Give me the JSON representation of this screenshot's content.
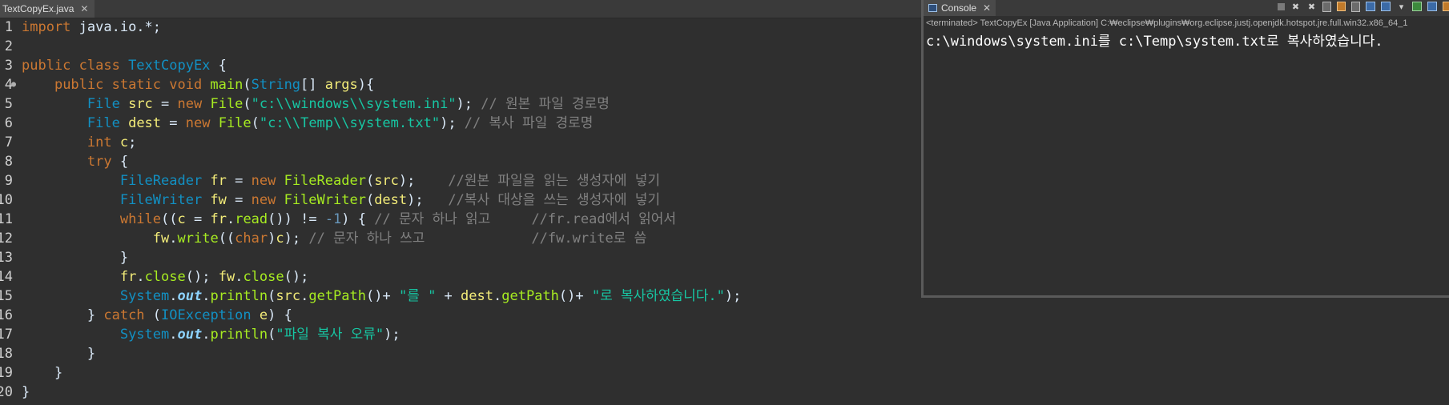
{
  "editor": {
    "tab_title": "TextCopyEx.java",
    "tab_close": "✕"
  },
  "code_lines": [
    {
      "num": "1",
      "marker": "",
      "tokens": [
        [
          "kw",
          "import"
        ],
        [
          "plain",
          " java.io.*;"
        ]
      ]
    },
    {
      "num": "2",
      "marker": "",
      "tokens": []
    },
    {
      "num": "3",
      "marker": "",
      "tokens": [
        [
          "kw",
          "public class "
        ],
        [
          "cls",
          "TextCopyEx"
        ],
        [
          "plain",
          " {"
        ]
      ]
    },
    {
      "num": "4",
      "marker": "●",
      "tokens": [
        [
          "plain",
          "    "
        ],
        [
          "kw",
          "public static void "
        ],
        [
          "fn",
          "main"
        ],
        [
          "plain",
          "("
        ],
        [
          "cls",
          "String"
        ],
        [
          "plain",
          "[] "
        ],
        [
          "var",
          "args"
        ],
        [
          "plain",
          "){"
        ]
      ]
    },
    {
      "num": "5",
      "marker": "",
      "tokens": [
        [
          "plain",
          "        "
        ],
        [
          "cls",
          "File "
        ],
        [
          "var",
          "src"
        ],
        [
          "plain",
          " = "
        ],
        [
          "kw",
          "new "
        ],
        [
          "fn",
          "File"
        ],
        [
          "plain",
          "("
        ],
        [
          "str",
          "\"c:\\\\windows\\\\system.ini\""
        ],
        [
          "plain",
          "); "
        ],
        [
          "cmt",
          "// 원본 파일 경로명"
        ]
      ]
    },
    {
      "num": "6",
      "marker": "",
      "tokens": [
        [
          "plain",
          "        "
        ],
        [
          "cls",
          "File "
        ],
        [
          "var",
          "dest"
        ],
        [
          "plain",
          " = "
        ],
        [
          "kw",
          "new "
        ],
        [
          "fn",
          "File"
        ],
        [
          "plain",
          "("
        ],
        [
          "str",
          "\"c:\\\\Temp\\\\system.txt\""
        ],
        [
          "plain",
          "); "
        ],
        [
          "cmt",
          "// 복사 파일 경로명"
        ]
      ]
    },
    {
      "num": "7",
      "marker": "",
      "tokens": [
        [
          "plain",
          "        "
        ],
        [
          "kw",
          "int "
        ],
        [
          "var",
          "c"
        ],
        [
          "plain",
          ";"
        ]
      ]
    },
    {
      "num": "8",
      "marker": "",
      "tokens": [
        [
          "plain",
          "        "
        ],
        [
          "kw",
          "try"
        ],
        [
          "plain",
          " {"
        ]
      ]
    },
    {
      "num": "9",
      "marker": "",
      "tokens": [
        [
          "plain",
          "            "
        ],
        [
          "cls",
          "FileReader "
        ],
        [
          "var",
          "fr"
        ],
        [
          "plain",
          " = "
        ],
        [
          "kw",
          "new "
        ],
        [
          "fn",
          "FileReader"
        ],
        [
          "plain",
          "("
        ],
        [
          "var",
          "src"
        ],
        [
          "plain",
          ");    "
        ],
        [
          "cmt",
          "//원본 파일을 읽는 생성자에 넣기"
        ]
      ]
    },
    {
      "num": "10",
      "marker": "",
      "tokens": [
        [
          "plain",
          "            "
        ],
        [
          "cls",
          "FileWriter "
        ],
        [
          "var",
          "fw"
        ],
        [
          "plain",
          " = "
        ],
        [
          "kw",
          "new "
        ],
        [
          "fn",
          "FileWriter"
        ],
        [
          "plain",
          "("
        ],
        [
          "var",
          "dest"
        ],
        [
          "plain",
          ");   "
        ],
        [
          "cmt",
          "//복사 대상을 쓰는 생성자에 넣기"
        ]
      ]
    },
    {
      "num": "11",
      "marker": "",
      "tokens": [
        [
          "plain",
          "            "
        ],
        [
          "kw",
          "while"
        ],
        [
          "plain",
          "(("
        ],
        [
          "var",
          "c"
        ],
        [
          "plain",
          " = "
        ],
        [
          "var",
          "fr"
        ],
        [
          "plain",
          "."
        ],
        [
          "fn",
          "read"
        ],
        [
          "plain",
          "()) != "
        ],
        [
          "num",
          "-1"
        ],
        [
          "plain",
          ") { "
        ],
        [
          "cmt",
          "// 문자 하나 읽고     //"
        ],
        [
          "cmt",
          "fr.read"
        ],
        [
          "cmt",
          "에서 읽어서"
        ]
      ]
    },
    {
      "num": "12",
      "marker": "",
      "tokens": [
        [
          "plain",
          "                "
        ],
        [
          "var",
          "fw"
        ],
        [
          "plain",
          "."
        ],
        [
          "fn",
          "write"
        ],
        [
          "plain",
          "(("
        ],
        [
          "kw",
          "char"
        ],
        [
          "plain",
          ")"
        ],
        [
          "var",
          "c"
        ],
        [
          "plain",
          "); "
        ],
        [
          "cmt",
          "// 문자 하나 쓰고             //"
        ],
        [
          "cmt",
          "fw.write"
        ],
        [
          "cmt",
          "로 씀"
        ]
      ]
    },
    {
      "num": "13",
      "marker": "",
      "tokens": [
        [
          "plain",
          "            }"
        ]
      ]
    },
    {
      "num": "14",
      "marker": "",
      "tokens": [
        [
          "plain",
          "            "
        ],
        [
          "var",
          "fr"
        ],
        [
          "plain",
          "."
        ],
        [
          "fn",
          "close"
        ],
        [
          "plain",
          "(); "
        ],
        [
          "var",
          "fw"
        ],
        [
          "plain",
          "."
        ],
        [
          "fn",
          "close"
        ],
        [
          "plain",
          "();"
        ]
      ]
    },
    {
      "num": "15",
      "marker": "",
      "tokens": [
        [
          "plain",
          "            "
        ],
        [
          "cls",
          "System"
        ],
        [
          "plain",
          "."
        ],
        [
          "out",
          "out"
        ],
        [
          "plain",
          "."
        ],
        [
          "fn",
          "println"
        ],
        [
          "plain",
          "("
        ],
        [
          "var",
          "src"
        ],
        [
          "plain",
          "."
        ],
        [
          "fn",
          "getPath"
        ],
        [
          "plain",
          "()+ "
        ],
        [
          "str",
          "\"를 \""
        ],
        [
          "plain",
          " + "
        ],
        [
          "var",
          "dest"
        ],
        [
          "plain",
          "."
        ],
        [
          "fn",
          "getPath"
        ],
        [
          "plain",
          "()+ "
        ],
        [
          "str",
          "\"로 복사하였습니다.\""
        ],
        [
          "plain",
          ");"
        ]
      ]
    },
    {
      "num": "16",
      "marker": "",
      "tokens": [
        [
          "plain",
          "        } "
        ],
        [
          "kw",
          "catch"
        ],
        [
          "plain",
          " ("
        ],
        [
          "cls",
          "IOException "
        ],
        [
          "var",
          "e"
        ],
        [
          "plain",
          ") {"
        ]
      ]
    },
    {
      "num": "17",
      "marker": "",
      "tokens": [
        [
          "plain",
          "            "
        ],
        [
          "cls",
          "System"
        ],
        [
          "plain",
          "."
        ],
        [
          "out",
          "out"
        ],
        [
          "plain",
          "."
        ],
        [
          "fn",
          "println"
        ],
        [
          "plain",
          "("
        ],
        [
          "str",
          "\"파일 복사 오류\""
        ],
        [
          "plain",
          ");"
        ]
      ]
    },
    {
      "num": "18",
      "marker": "",
      "tokens": [
        [
          "plain",
          "        }"
        ]
      ]
    },
    {
      "num": "19",
      "marker": "",
      "tokens": [
        [
          "plain",
          "    }"
        ]
      ]
    },
    {
      "num": "20",
      "marker": "",
      "tokens": [
        [
          "plain",
          "}"
        ]
      ]
    }
  ],
  "console": {
    "tab_title": "Console",
    "tab_close": "✕",
    "status": "<terminated> TextCopyEx [Java Application] C:₩eclipse₩plugins₩org.eclipse.justj.openjdk.hotspot.jre.full.win32.x86_64_1",
    "output": "c:\\windows\\system.ini를 c:\\Temp\\system.txt로 복사하였습니다.",
    "toolbar_icons": [
      "stop-icon",
      "remove-launch-icon",
      "remove-all-icon",
      "clear-console-icon",
      "scroll-lock-icon",
      "word-wrap-icon",
      "pin-console-icon",
      "display-selected-console-icon",
      "open-console-icon",
      "view-menu-icon",
      "minimize-icon",
      "maximize-icon"
    ]
  },
  "colors": {
    "background": "#2f2f2f",
    "keyword": "#cc7832",
    "class": "#1290c3",
    "method": "#a7ec21",
    "string": "#17c6a3",
    "comment": "#808080",
    "variable": "#f3ec79"
  }
}
